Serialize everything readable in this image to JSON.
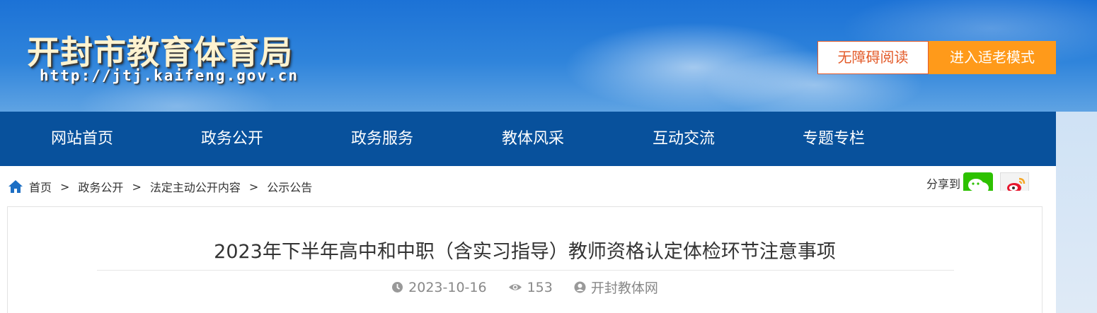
{
  "header": {
    "site_title": "开封市教育体育局",
    "site_url": "http://jtj.kaifeng.gov.cn",
    "accessible_reading_label": "无障碍阅读",
    "elder_mode_label": "进入适老模式",
    "colors": {
      "nav_bg": "#08519c",
      "accessible_border": "#e35b2a",
      "elder_bg": "#ff9a1a"
    }
  },
  "nav": {
    "items": [
      {
        "label": "网站首页"
      },
      {
        "label": "政务公开"
      },
      {
        "label": "政务服务"
      },
      {
        "label": "教体风采"
      },
      {
        "label": "互动交流"
      },
      {
        "label": "专题专栏"
      }
    ]
  },
  "breadcrumb": {
    "icon": "home-icon",
    "items": [
      {
        "label": "首页"
      },
      {
        "label": "政务公开"
      },
      {
        "label": "法定主动公开内容"
      },
      {
        "label": "公示公告"
      }
    ],
    "separator": ">"
  },
  "share": {
    "label": "分享到",
    "targets": [
      "wechat-icon",
      "weibo-icon"
    ]
  },
  "article": {
    "title": "2023年下半年高中和中职（含实习指导）教师资格认定体检环节注意事项",
    "date": "2023-10-16",
    "views": "153",
    "source": "开封教体网"
  }
}
